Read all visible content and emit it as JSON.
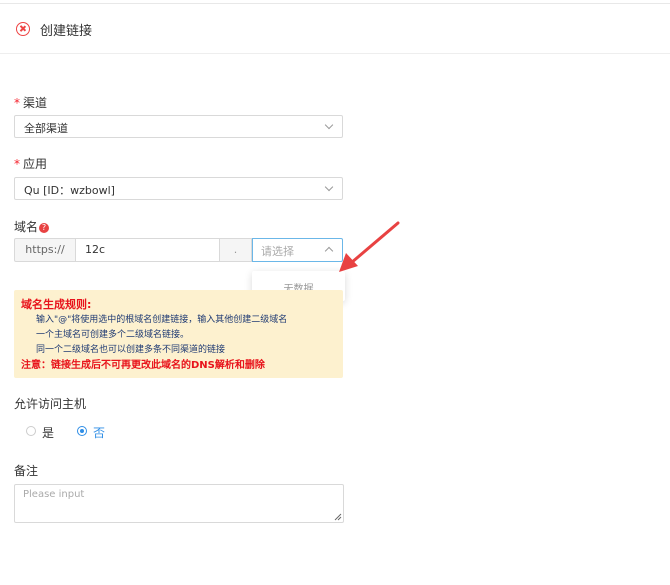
{
  "header": {
    "title": "创建链接",
    "close_icon": "close-circle-icon"
  },
  "form": {
    "channel": {
      "label": "渠道",
      "value": "全部渠道"
    },
    "app": {
      "label": "应用",
      "value": "Qu [ID：wzbowl]"
    },
    "domain": {
      "label": "域名",
      "help_icon": "?",
      "prefix": "https://",
      "subdomain": "12c",
      "separator": ".",
      "root_placeholder": "请选择",
      "dropdown_empty": "无数据"
    },
    "rules": {
      "title": "域名生成规则:",
      "lines": [
        "输入\"@\"将使用选中的根域名创建链接，输入其他创建二级域名",
        "一个主域名可创建多个二级域名链接。",
        "同一个二级域名也可以创建多条不同渠道的链接"
      ],
      "note": "注意：链接生成后不可再更改此域名的DNS解析和删除"
    },
    "allow_host": {
      "label": "允许访问主机",
      "options": [
        {
          "label": "是",
          "selected": false
        },
        {
          "label": "否",
          "selected": true
        }
      ]
    },
    "remark": {
      "label": "备注",
      "placeholder": "Please input"
    }
  },
  "colors": {
    "accent": "#2f8ee6",
    "danger": "#e8131b",
    "warning_bg": "#fdf1cf",
    "arrow": "#e84242"
  }
}
